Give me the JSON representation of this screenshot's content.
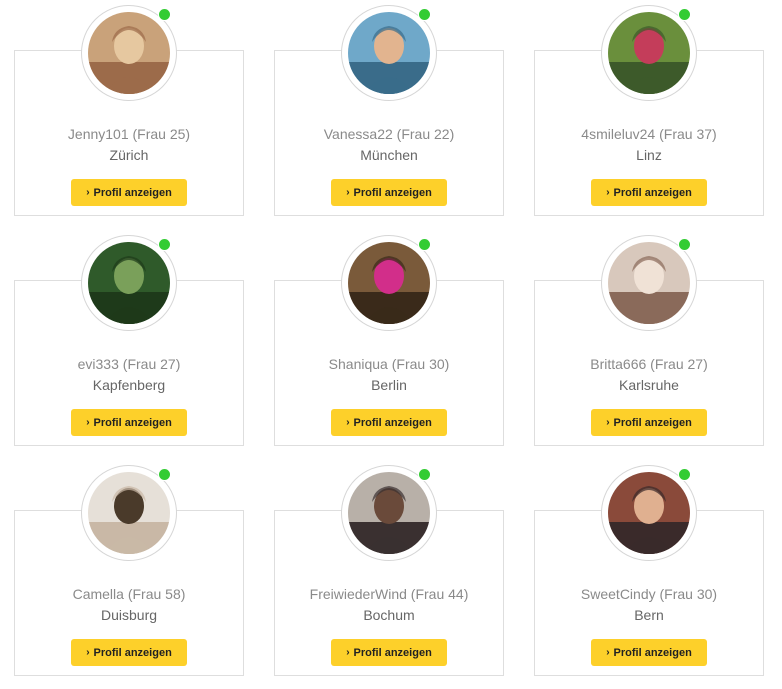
{
  "button_label": "Profil anzeigen",
  "online_color": "#33cc33",
  "button_color": "#fdd02a",
  "profiles": [
    {
      "username": "Jenny101",
      "meta": "(Frau 25)",
      "city": "Zürich",
      "online": true
    },
    {
      "username": "Vanessa22",
      "meta": "(Frau 22)",
      "city": "München",
      "online": true
    },
    {
      "username": "4smileluv24",
      "meta": "(Frau 37)",
      "city": "Linz",
      "online": true
    },
    {
      "username": "evi333",
      "meta": "(Frau 27)",
      "city": "Kapfenberg",
      "online": true
    },
    {
      "username": "Shaniqua",
      "meta": "(Frau 30)",
      "city": "Berlin",
      "online": true
    },
    {
      "username": "Britta666",
      "meta": "(Frau 27)",
      "city": "Karlsruhe",
      "online": true
    },
    {
      "username": "Camella",
      "meta": "(Frau 58)",
      "city": "Duisburg",
      "online": true
    },
    {
      "username": "FreiwiederWind",
      "meta": "(Frau 44)",
      "city": "Bochum",
      "online": true
    },
    {
      "username": "SweetCindy",
      "meta": "(Frau 30)",
      "city": "Bern",
      "online": true
    }
  ]
}
